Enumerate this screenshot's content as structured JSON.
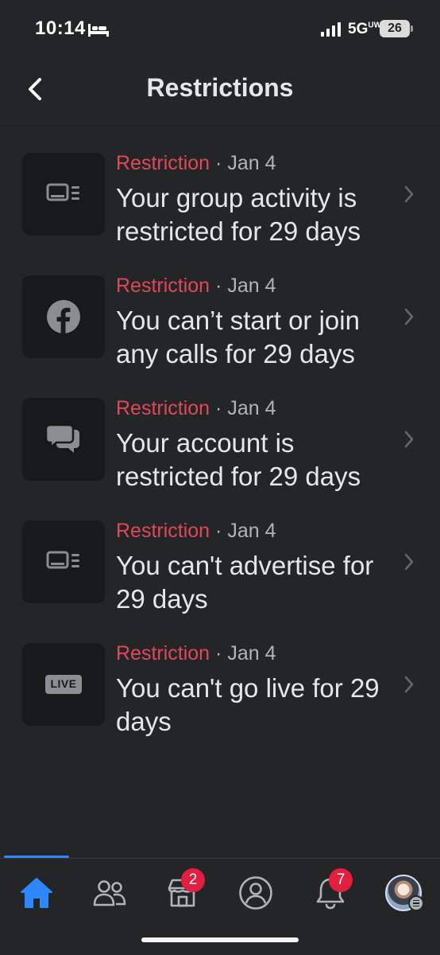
{
  "status_bar": {
    "time": "10:14",
    "network": "5G",
    "network_suffix": "UW",
    "battery": "26"
  },
  "header": {
    "title": "Restrictions"
  },
  "items": [
    {
      "type": "Restriction",
      "separator": "·",
      "date": "Jan 4",
      "title": "Your group activity is restricted for 29 days",
      "icon": "monitor-list-icon"
    },
    {
      "type": "Restriction",
      "separator": "·",
      "date": "Jan 4",
      "title": "You can’t start or join any calls for 29 days",
      "icon": "facebook-icon"
    },
    {
      "type": "Restriction",
      "separator": "·",
      "date": "Jan 4",
      "title": "Your account is restricted for 29 days",
      "icon": "chat-bubbles-icon"
    },
    {
      "type": "Restriction",
      "separator": "·",
      "date": "Jan 4",
      "title": "You can't advertise for 29 days",
      "icon": "monitor-list-icon"
    },
    {
      "type": "Restriction",
      "separator": "·",
      "date": "Jan 4",
      "title": "You can't go live for 29 days",
      "icon": "live-icon",
      "icon_text": "LIVE"
    }
  ],
  "tabbar": {
    "tabs": [
      {
        "name": "home",
        "icon": "home-icon",
        "active": true
      },
      {
        "name": "friends",
        "icon": "friends-icon"
      },
      {
        "name": "marketplace",
        "icon": "marketplace-icon",
        "badge": "2"
      },
      {
        "name": "profile",
        "icon": "profile-icon"
      },
      {
        "name": "notifications",
        "icon": "bell-icon",
        "badge": "7"
      },
      {
        "name": "menu",
        "icon": "avatar"
      }
    ]
  },
  "colors": {
    "background": "#242526",
    "restriction": "#e0485a",
    "accent": "#2d88ff",
    "badge": "#e41e3f"
  }
}
